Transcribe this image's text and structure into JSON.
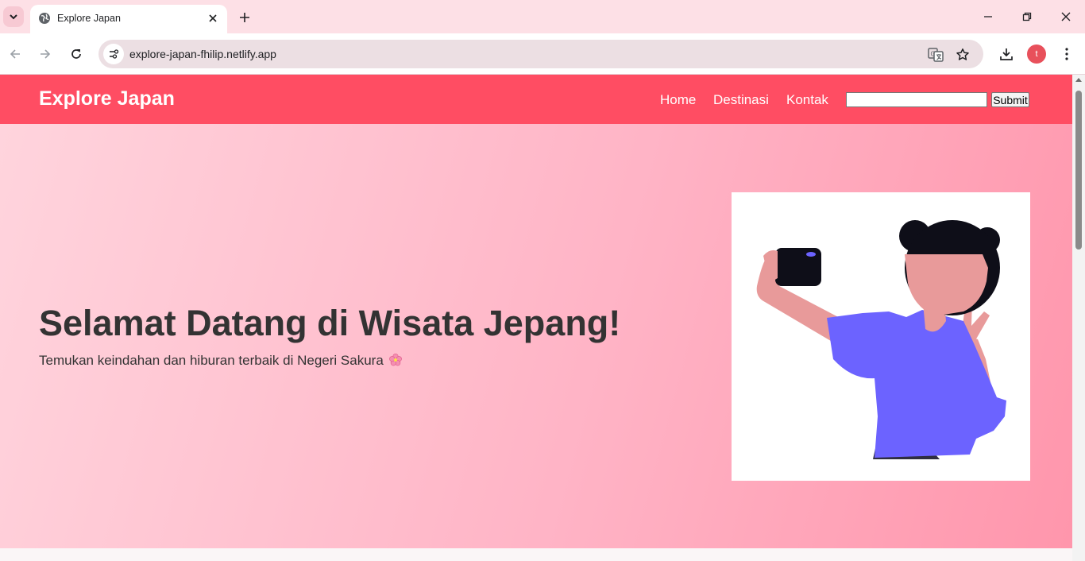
{
  "browser": {
    "tab_title": "Explore Japan",
    "url": "explore-japan-fhilip.netlify.app",
    "profile_initial": "t",
    "icons": [
      "tab-list-icon",
      "globe-icon",
      "close-icon",
      "plus-icon",
      "minimize-icon",
      "restore-icon",
      "back-icon",
      "forward-icon",
      "reload-icon",
      "site-info-icon",
      "translate-icon",
      "star-icon",
      "download-icon",
      "more-icon"
    ]
  },
  "site": {
    "brand": "Explore Japan",
    "nav": [
      "Home",
      "Destinasi",
      "Kontak"
    ],
    "search_value": "",
    "submit_label": "Submit",
    "colors": {
      "header": "#ff4d63",
      "hero_start": "#ffd4dd",
      "hero_end": "#ff96ac",
      "text": "#333333",
      "shirt": "#6c63ff",
      "skin": "#e89a9a"
    }
  },
  "hero": {
    "title": "Selamat Datang di Wisata Jepang!",
    "subtitle": "Temukan keindahan dan hiburan terbaik di Negeri Sakura",
    "subtitle_emoji": "cherry-blossom-icon",
    "image": "woman-taking-selfie-illustration"
  }
}
